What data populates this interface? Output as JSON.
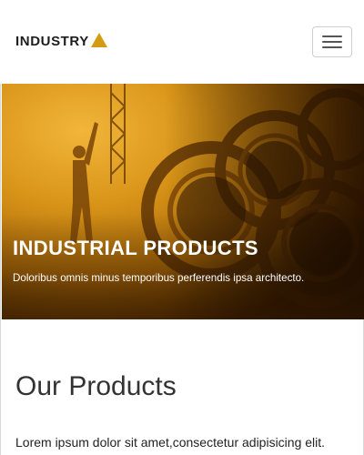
{
  "navbar": {
    "brand": "INDUSTRY",
    "brand_accent_color": "#d49a12",
    "toggle_icon": "hamburger-menu-icon"
  },
  "hero": {
    "title": "INDUSTRIAL PRODUCTS",
    "subtitle": "Doloribus omnis minus temporibus perferendis ipsa architecto."
  },
  "products": {
    "heading": "Our Products",
    "text": "Lorem ipsum dolor sit amet,consectetur adipisicing elit."
  },
  "colors": {
    "hero_tone": "#c98a12",
    "hero_dark": "#2a1600"
  }
}
